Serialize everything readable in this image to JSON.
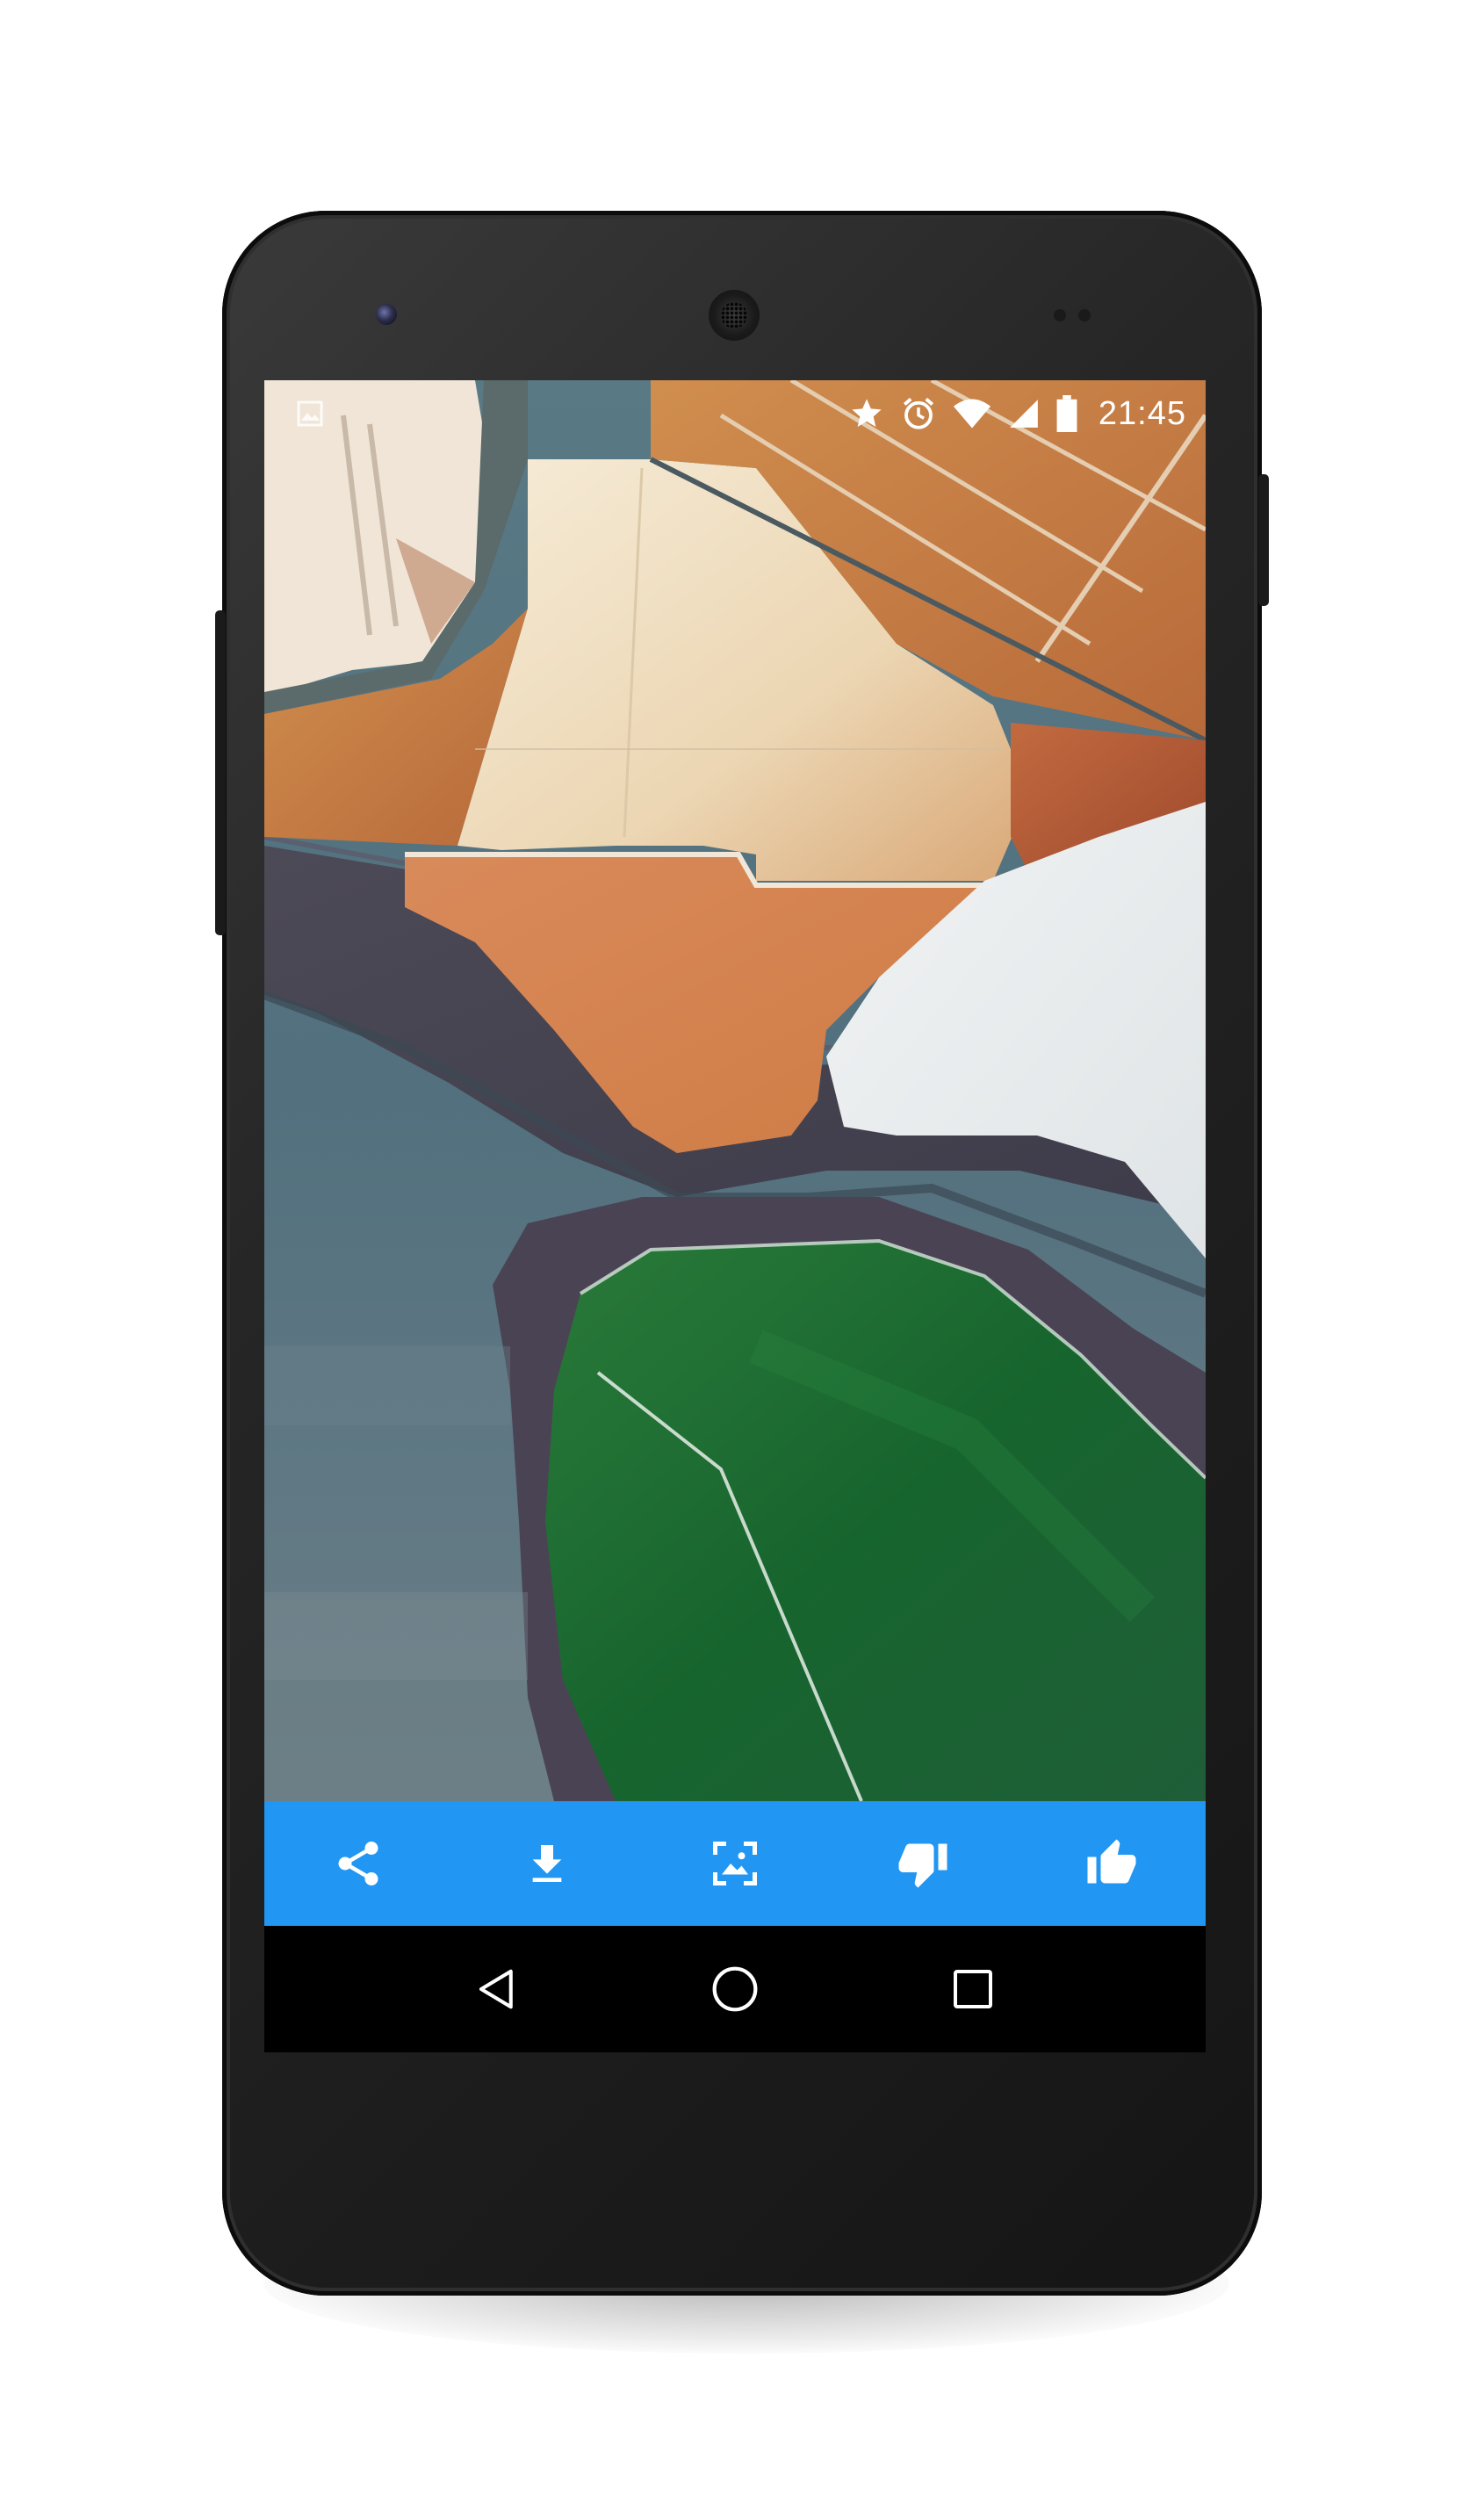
{
  "status_bar": {
    "time": "21:45",
    "icons": [
      "image-notification-icon",
      "star-icon",
      "alarm-clock-icon",
      "wifi-icon",
      "cell-signal-icon",
      "battery-icon"
    ]
  },
  "wallpaper": {
    "description_icon": "aerial-salt-ponds-image",
    "colors": {
      "orange": "#c98b4f",
      "rust": "#b55d3c",
      "cream": "#f1e4cc",
      "white_salt": "#e8ecee",
      "water_blue": "#4c6c7a",
      "green": "#1c6a35",
      "marsh": "#4a4354"
    }
  },
  "action_bar": {
    "background": "#2196f3",
    "buttons": [
      "share-icon",
      "download-icon",
      "set-wallpaper-icon",
      "thumbs-down-icon",
      "thumbs-up-icon"
    ]
  },
  "nav_bar": {
    "buttons": [
      "back-icon",
      "home-icon",
      "recents-icon"
    ]
  },
  "device": {
    "body_color": "#222222",
    "icon_color": "#ffffff"
  }
}
